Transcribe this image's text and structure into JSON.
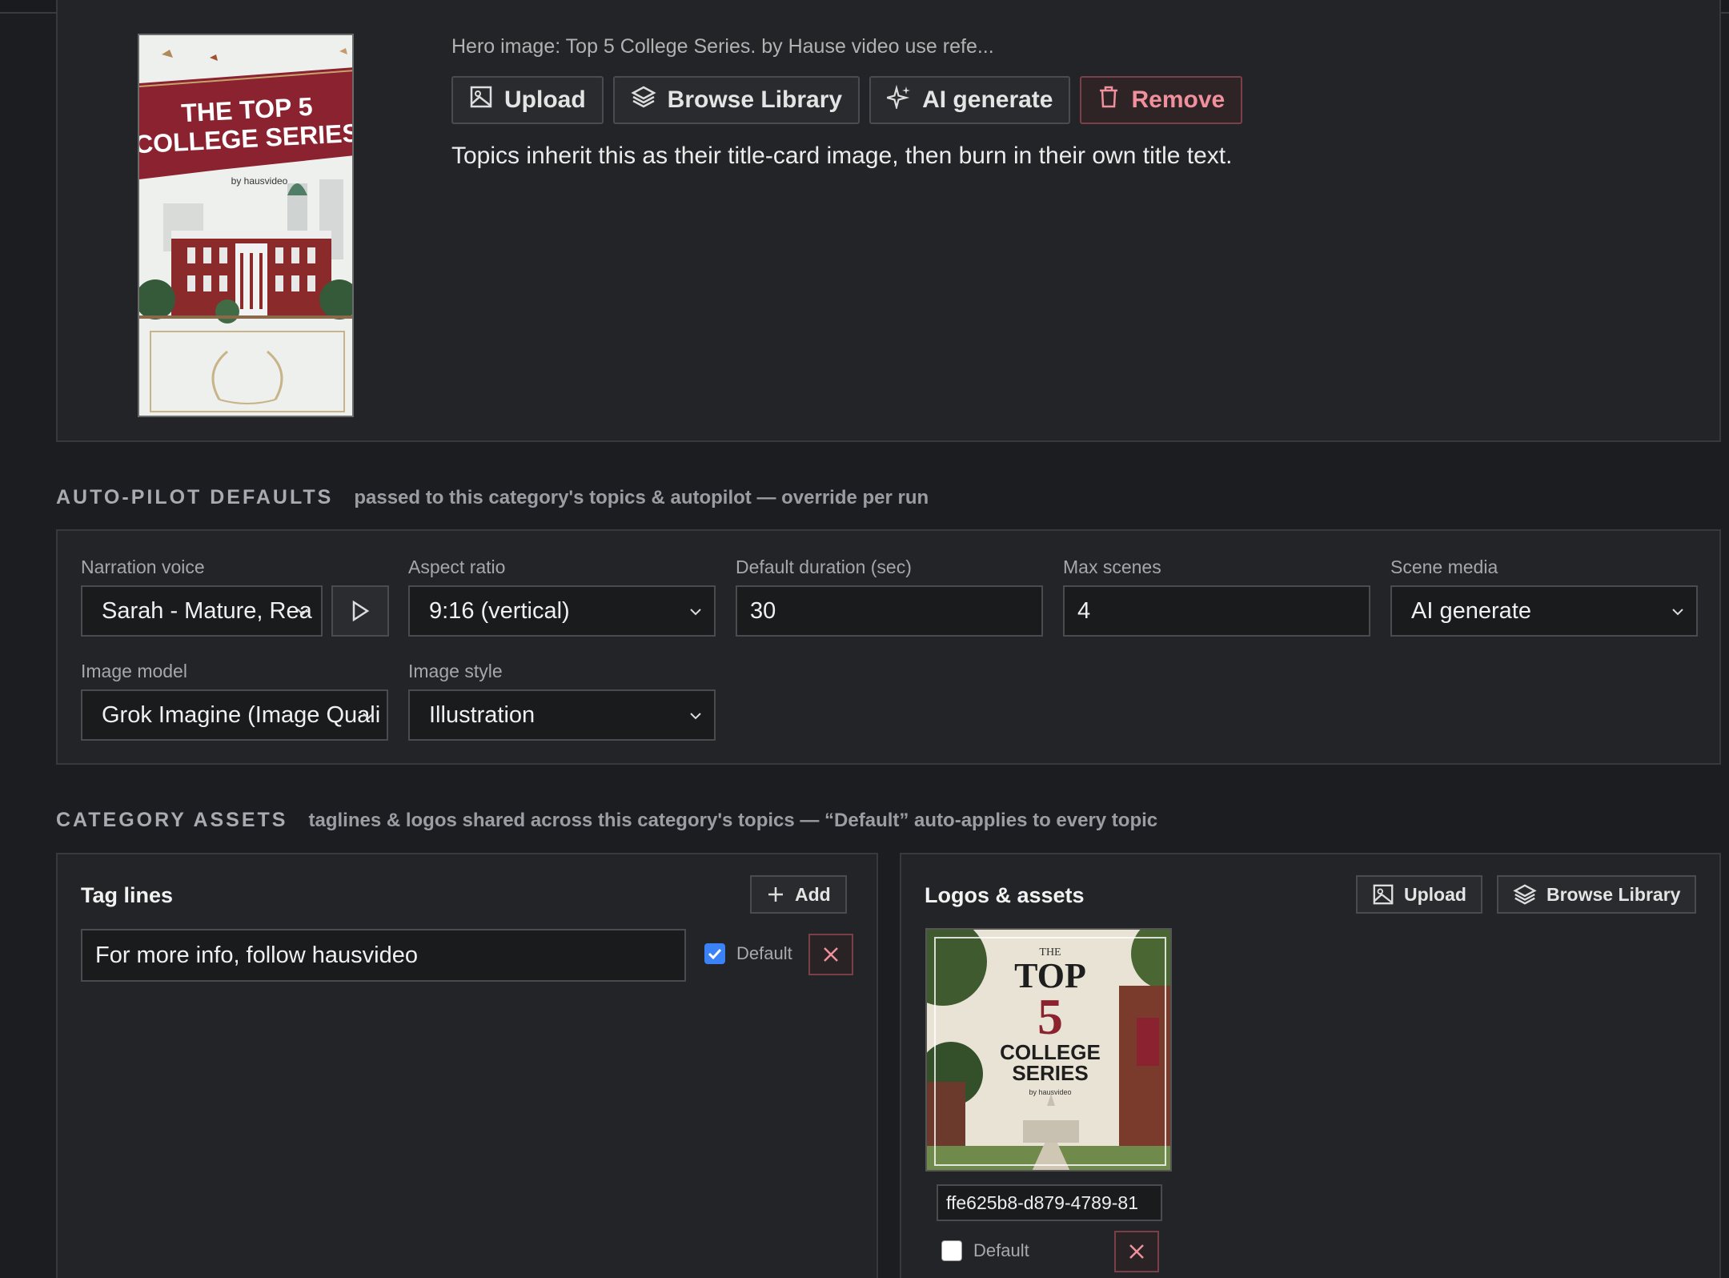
{
  "hero": {
    "caption": "Hero image: Top 5 College Series. by Hause video use refe...",
    "buttons": {
      "upload": "Upload",
      "browse": "Browse Library",
      "ai": "AI generate",
      "remove": "Remove"
    },
    "note": "Topics inherit this as their title-card image, then burn in their own title text.",
    "thumb_title_line1": "THE TOP 5",
    "thumb_title_line2": "COLLEGE SERIES",
    "thumb_byline": "by hausvideo"
  },
  "autopilot": {
    "title": "AUTO-PILOT DEFAULTS",
    "subtitle": "passed to this category's topics & autopilot — override per run",
    "narration_label": "Narration voice",
    "narration_value": "Sarah - Mature, Rea",
    "aspect_label": "Aspect ratio",
    "aspect_value": "9:16 (vertical)",
    "duration_label": "Default duration (sec)",
    "duration_value": "30",
    "maxscenes_label": "Max scenes",
    "maxscenes_value": "4",
    "scenemedia_label": "Scene media",
    "scenemedia_value": "AI generate",
    "imagemodel_label": "Image model",
    "imagemodel_value": "Grok Imagine (Image Quali",
    "imagestyle_label": "Image style",
    "imagestyle_value": "Illustration"
  },
  "assets": {
    "title": "CATEGORY ASSETS",
    "subtitle": "taglines & logos shared across this category's topics — “Default” auto-applies to every topic",
    "taglines": {
      "title": "Tag lines",
      "add_label": "Add",
      "items": [
        {
          "text": "For more info, follow hausvideo",
          "default_label": "Default",
          "is_default": true
        }
      ]
    },
    "logos": {
      "title": "Logos & assets",
      "upload_label": "Upload",
      "browse_label": "Browse Library",
      "items": [
        {
          "name": "ffe625b8-d879-4789-81",
          "default_label": "Default",
          "is_default": false,
          "thumb_the": "THE",
          "thumb_top": "TOP",
          "thumb_num": "5",
          "thumb_college": "COLLEGE",
          "thumb_series": "SERIES",
          "thumb_by": "by hausvideo"
        }
      ]
    }
  },
  "colors": {
    "background": "#1c1d20",
    "panel": "#232427",
    "danger": "#f1909d",
    "checkbox_accent": "#3b82f6",
    "maroon": "#8b2230"
  }
}
